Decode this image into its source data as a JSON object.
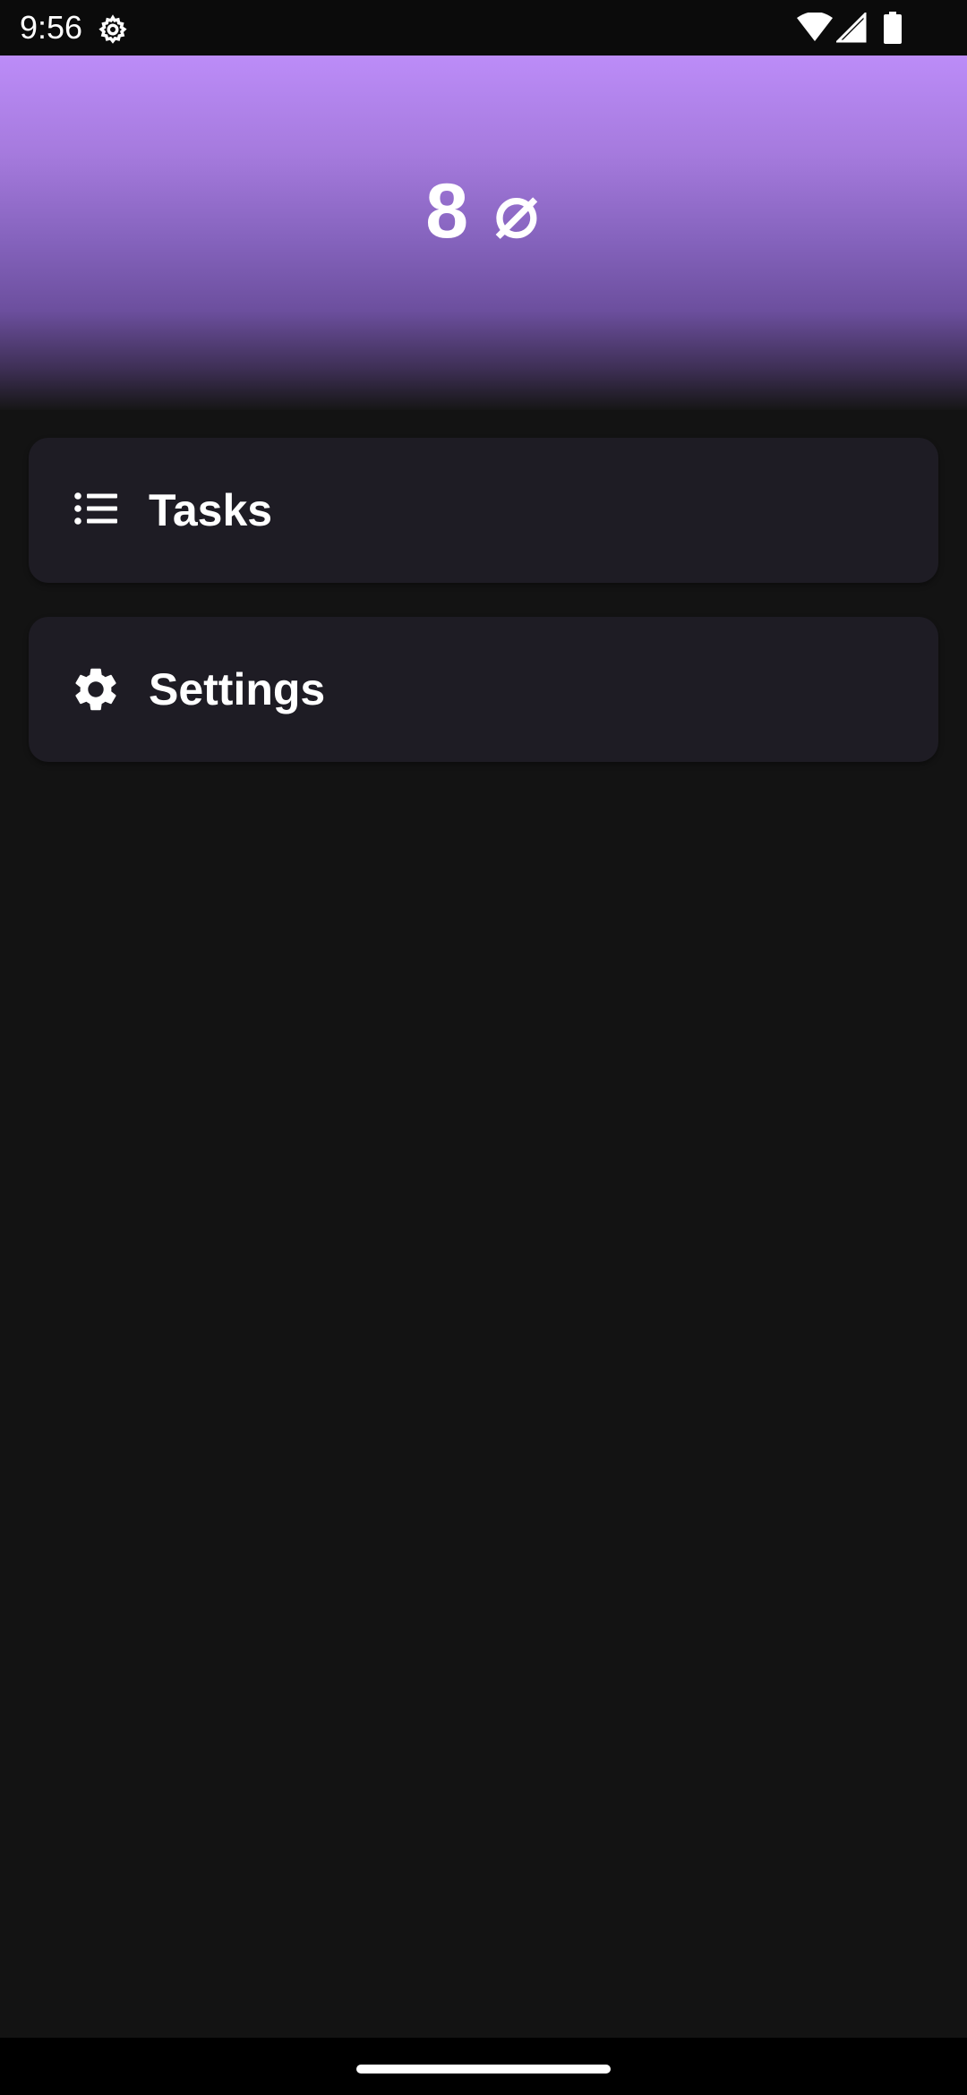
{
  "status_bar": {
    "time": "9:56",
    "icons": [
      "gear-icon",
      "wifi-icon",
      "signal-icon",
      "battery-icon"
    ]
  },
  "header": {
    "title": "8 ⌀",
    "gradient_top": "#bc8cf8",
    "gradient_bottom": "#161616"
  },
  "menu": {
    "items": [
      {
        "label": "Tasks",
        "icon": "list-icon"
      },
      {
        "label": "Settings",
        "icon": "gear-icon"
      }
    ]
  },
  "colors": {
    "background": "#131313",
    "card": "#1e1c24",
    "text": "#ffffff"
  }
}
